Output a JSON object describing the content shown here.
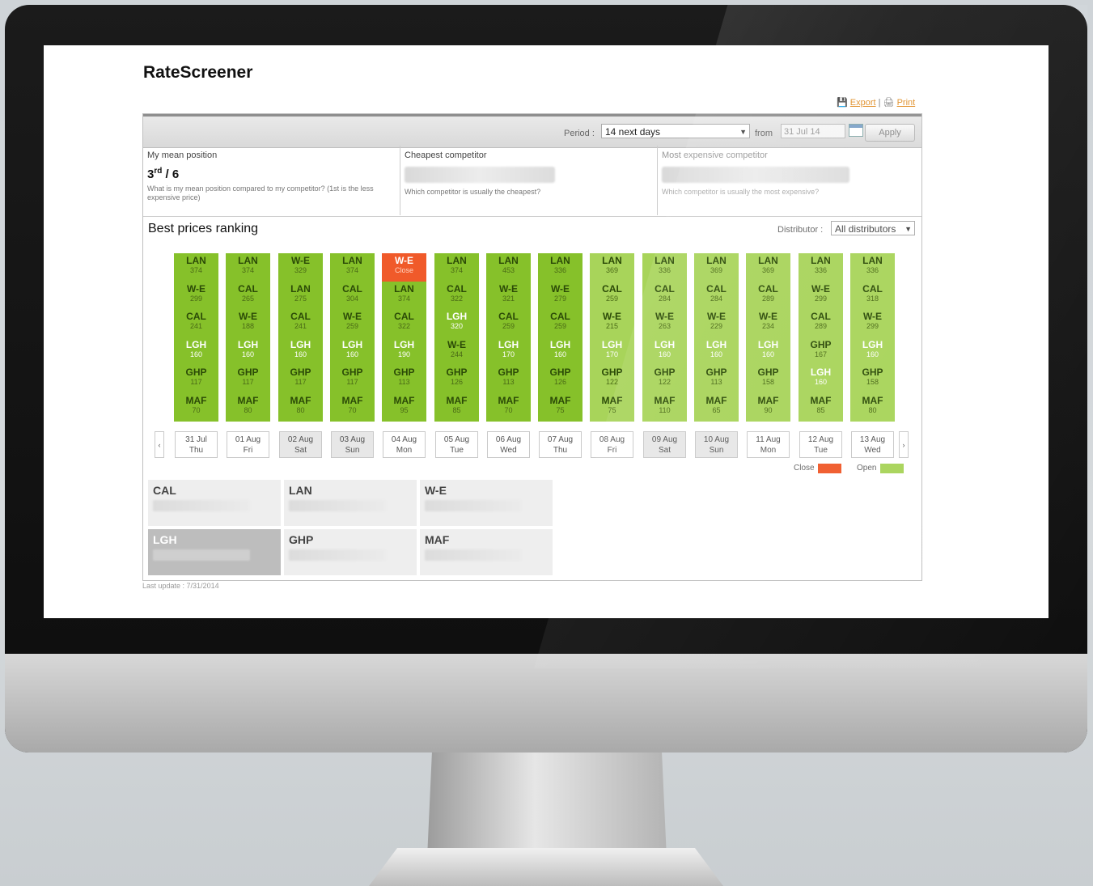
{
  "app": {
    "title": "RateScreener"
  },
  "links": {
    "export": "Export",
    "separator": "|",
    "print": "Print"
  },
  "toolbar": {
    "period_label": "Period :",
    "period_value": "14 next days",
    "from_label": "from",
    "from_value": "31 Jul 14",
    "apply_label": "Apply"
  },
  "stats": {
    "mean_position": {
      "title": "My mean position",
      "rank": "3",
      "rank_suffix": "rd",
      "rank_total": " / 6",
      "desc": "What is my mean position compared to my competitor? (1st is the less expensive price)"
    },
    "cheapest": {
      "title": "Cheapest competitor",
      "desc": "Which competitor is usually the cheapest?"
    },
    "most_expensive": {
      "title": "Most expensive competitor",
      "desc": "Which competitor is usually the most expensive?"
    }
  },
  "ranking": {
    "title": "Best prices ranking",
    "distributor_label": "Distributor :",
    "distributor_value": "All distributors",
    "columns": [
      {
        "day": "31 Jul",
        "weekday": "Thu",
        "cells": [
          [
            "LAN",
            "374"
          ],
          [
            "W-E",
            "299"
          ],
          [
            "CAL",
            "241"
          ],
          [
            "LGH",
            "160"
          ],
          [
            "GHP",
            "117"
          ],
          [
            "MAF",
            "70"
          ]
        ]
      },
      {
        "day": "01 Aug",
        "weekday": "Fri",
        "cells": [
          [
            "LAN",
            "374"
          ],
          [
            "CAL",
            "265"
          ],
          [
            "W-E",
            "188"
          ],
          [
            "LGH",
            "160"
          ],
          [
            "GHP",
            "117"
          ],
          [
            "MAF",
            "80"
          ]
        ]
      },
      {
        "day": "02 Aug",
        "weekday": "Sat",
        "cells": [
          [
            "W-E",
            "329"
          ],
          [
            "LAN",
            "275"
          ],
          [
            "CAL",
            "241"
          ],
          [
            "LGH",
            "160"
          ],
          [
            "GHP",
            "117"
          ],
          [
            "MAF",
            "80"
          ]
        ]
      },
      {
        "day": "03 Aug",
        "weekday": "Sun",
        "cells": [
          [
            "LAN",
            "374"
          ],
          [
            "CAL",
            "304"
          ],
          [
            "W-E",
            "259"
          ],
          [
            "LGH",
            "160"
          ],
          [
            "GHP",
            "117"
          ],
          [
            "MAF",
            "70"
          ]
        ]
      },
      {
        "day": "04 Aug",
        "weekday": "Mon",
        "cells": [
          [
            "W-E",
            "Close"
          ],
          [
            "LAN",
            "374"
          ],
          [
            "CAL",
            "322"
          ],
          [
            "LGH",
            "190"
          ],
          [
            "GHP",
            "113"
          ],
          [
            "MAF",
            "95"
          ]
        ]
      },
      {
        "day": "05 Aug",
        "weekday": "Tue",
        "cells": [
          [
            "LAN",
            "374"
          ],
          [
            "CAL",
            "322"
          ],
          [
            "LGH",
            "320"
          ],
          [
            "W-E",
            "244"
          ],
          [
            "GHP",
            "126"
          ],
          [
            "MAF",
            "85"
          ]
        ]
      },
      {
        "day": "06 Aug",
        "weekday": "Wed",
        "cells": [
          [
            "LAN",
            "453"
          ],
          [
            "W-E",
            "321"
          ],
          [
            "CAL",
            "259"
          ],
          [
            "LGH",
            "170"
          ],
          [
            "GHP",
            "113"
          ],
          [
            "MAF",
            "70"
          ]
        ]
      },
      {
        "day": "07 Aug",
        "weekday": "Thu",
        "cells": [
          [
            "LAN",
            "336"
          ],
          [
            "W-E",
            "279"
          ],
          [
            "CAL",
            "259"
          ],
          [
            "LGH",
            "160"
          ],
          [
            "GHP",
            "126"
          ],
          [
            "MAF",
            "75"
          ]
        ]
      },
      {
        "day": "08 Aug",
        "weekday": "Fri",
        "cells": [
          [
            "LAN",
            "369"
          ],
          [
            "CAL",
            "259"
          ],
          [
            "W-E",
            "215"
          ],
          [
            "LGH",
            "170"
          ],
          [
            "GHP",
            "122"
          ],
          [
            "MAF",
            "75"
          ]
        ]
      },
      {
        "day": "09 Aug",
        "weekday": "Sat",
        "cells": [
          [
            "LAN",
            "336"
          ],
          [
            "CAL",
            "284"
          ],
          [
            "W-E",
            "263"
          ],
          [
            "LGH",
            "160"
          ],
          [
            "GHP",
            "122"
          ],
          [
            "MAF",
            "110"
          ]
        ]
      },
      {
        "day": "10 Aug",
        "weekday": "Sun",
        "cells": [
          [
            "LAN",
            "369"
          ],
          [
            "CAL",
            "284"
          ],
          [
            "W-E",
            "229"
          ],
          [
            "LGH",
            "160"
          ],
          [
            "GHP",
            "113"
          ],
          [
            "MAF",
            "65"
          ]
        ]
      },
      {
        "day": "11 Aug",
        "weekday": "Mon",
        "cells": [
          [
            "LAN",
            "369"
          ],
          [
            "CAL",
            "289"
          ],
          [
            "W-E",
            "234"
          ],
          [
            "LGH",
            "160"
          ],
          [
            "GHP",
            "158"
          ],
          [
            "MAF",
            "90"
          ]
        ]
      },
      {
        "day": "12 Aug",
        "weekday": "Tue",
        "cells": [
          [
            "LAN",
            "336"
          ],
          [
            "W-E",
            "299"
          ],
          [
            "CAL",
            "289"
          ],
          [
            "GHP",
            "167"
          ],
          [
            "LGH",
            "160"
          ],
          [
            "MAF",
            "85"
          ]
        ]
      },
      {
        "day": "13 Aug",
        "weekday": "Wed",
        "cells": [
          [
            "LAN",
            "336"
          ],
          [
            "CAL",
            "318"
          ],
          [
            "W-E",
            "299"
          ],
          [
            "LGH",
            "160"
          ],
          [
            "GHP",
            "158"
          ],
          [
            "MAF",
            "80"
          ]
        ]
      }
    ],
    "legend": {
      "close_label": "Close",
      "open_label": "Open"
    },
    "colors": {
      "open_dark": "#86c12a",
      "open_light": "#a8d45a",
      "close": "#f05a2a",
      "own_hotel_text": "#ffffff"
    },
    "own_hotel": "LGH"
  },
  "competitors": [
    "CAL",
    "LAN",
    "W-E",
    "LGH",
    "GHP",
    "MAF"
  ],
  "footer": {
    "last_update": "Last update : 7/31/2014"
  }
}
